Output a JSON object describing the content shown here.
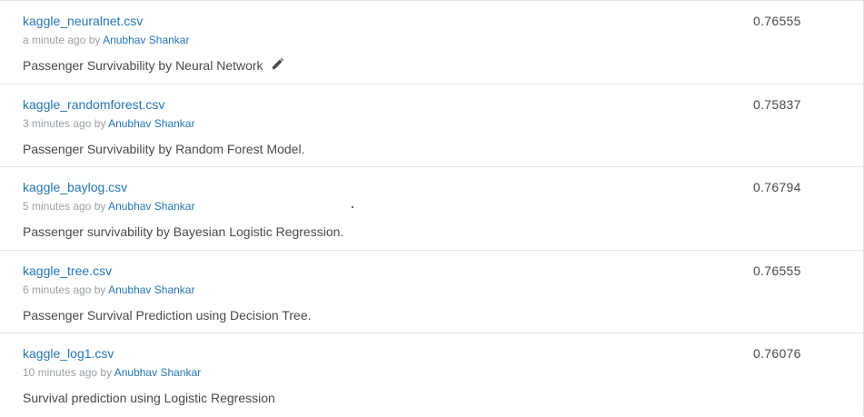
{
  "submissions": [
    {
      "file": "kaggle_neuralnet.csv",
      "time": "a minute ago by",
      "author": "Anubhav Shankar",
      "description": "Passenger Survivability by Neural Network",
      "score": "0.76555",
      "has_edit_icon": true
    },
    {
      "file": "kaggle_randomforest.csv",
      "time": "3 minutes ago by",
      "author": "Anubhav Shankar",
      "description": "Passenger Survivability by Random Forest Model.",
      "score": "0.75837"
    },
    {
      "file": "kaggle_baylog.csv",
      "time": "5 minutes ago by",
      "author": "Anubhav Shankar",
      "description": "Passenger survivability by Bayesian Logistic Regression.",
      "score": "0.76794"
    },
    {
      "file": "kaggle_tree.csv",
      "time": "6 minutes ago by",
      "author": "Anubhav Shankar",
      "description": "Passenger Survival Prediction using Decision Tree.",
      "score": "0.76555"
    },
    {
      "file": "kaggle_log1.csv",
      "time": "10 minutes ago by",
      "author": "Anubhav Shankar",
      "description": "Survival prediction using Logistic Regression",
      "score": "0.76076"
    }
  ],
  "icons": {
    "edit": "pencil-icon"
  }
}
